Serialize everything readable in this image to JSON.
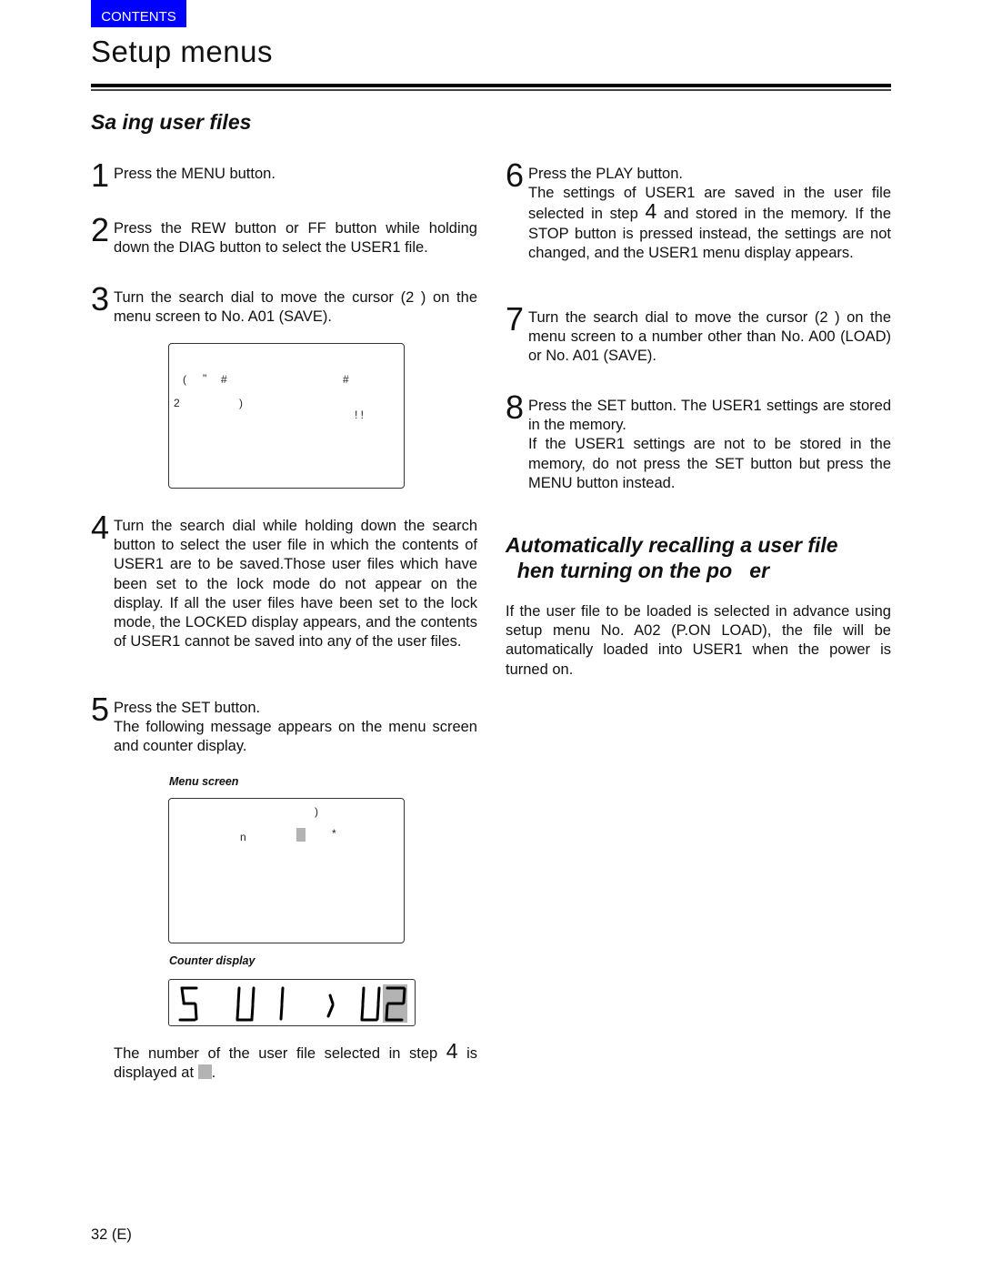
{
  "header": {
    "contents_label": "CONTENTS",
    "page_title": "Setup menus"
  },
  "left": {
    "section_title": "Sa  ing user files",
    "steps": [
      {
        "num": "1",
        "text": "Press the MENU button."
      },
      {
        "num": "2",
        "text": "Press the REW button or FF button while holding down the DIAG button to select the USER1 file."
      },
      {
        "num": "3",
        "text": "Turn the search dial to move the cursor (2 ) on the menu screen to No. A01 (SAVE)."
      },
      {
        "num": "4",
        "text": "Turn the search dial while holding down the search button to select the user file in which the contents of USER1 are to be saved.Those user files which have been set to the lock mode do not appear on the display. If all the user files have been set to the lock mode, the  LOCKED  display appears, and the contents of USER1 cannot be saved into any of the user files."
      },
      {
        "num": "5",
        "text": "Press the SET button.",
        "text2": "The following message appears on the menu screen and counter display."
      }
    ],
    "screen1_glyphs": [
      "(",
      "\"",
      "#",
      "#",
      "2",
      ")",
      "! !"
    ],
    "menu_screen_caption": "Menu screen",
    "screen2_glyphs": [
      ")",
      "n",
      "*"
    ],
    "counter_caption": "Counter display",
    "counter_chars": [
      "S",
      "U",
      "1",
      ">",
      "U",
      "2"
    ],
    "note_prefix": "The number of the user file selected in step ",
    "note_step": "4",
    "note_mid": " is displayed at ",
    "note_suffix": "."
  },
  "right": {
    "steps": [
      {
        "num": "6",
        "line1": "Press the PLAY button.",
        "pre": "The settings of USER1 are saved in the user file selected in step ",
        "ref": "4",
        "post": " and stored in the memory. If the STOP button is pressed instead, the settings are not changed, and the USER1 menu display appears."
      },
      {
        "num": "7",
        "text": "Turn the search dial to move the cursor (2 ) on the menu screen to a number other than No. A00 (LOAD) or No. A01 (SAVE)."
      },
      {
        "num": "8",
        "text": "Press the SET button. The USER1 settings are stored in the memory.",
        "text2": "If the USER1 settings are not to be stored in the memory, do not press the SET button but press the MENU button instead."
      }
    ],
    "section_title_line1": "Automatically recalling a user file",
    "section_title_line2": "  hen turning on the po   er",
    "paragraph": "If the user file to be loaded is selected in advance using setup menu No. A02 (P.ON LOAD), the file will be automatically loaded into USER1 when the power is turned on."
  },
  "footer": {
    "page_number": "32 (E)"
  },
  "colors": {
    "contents_bg": "#0000ff",
    "highlight_gray": "#b3b3b3"
  }
}
